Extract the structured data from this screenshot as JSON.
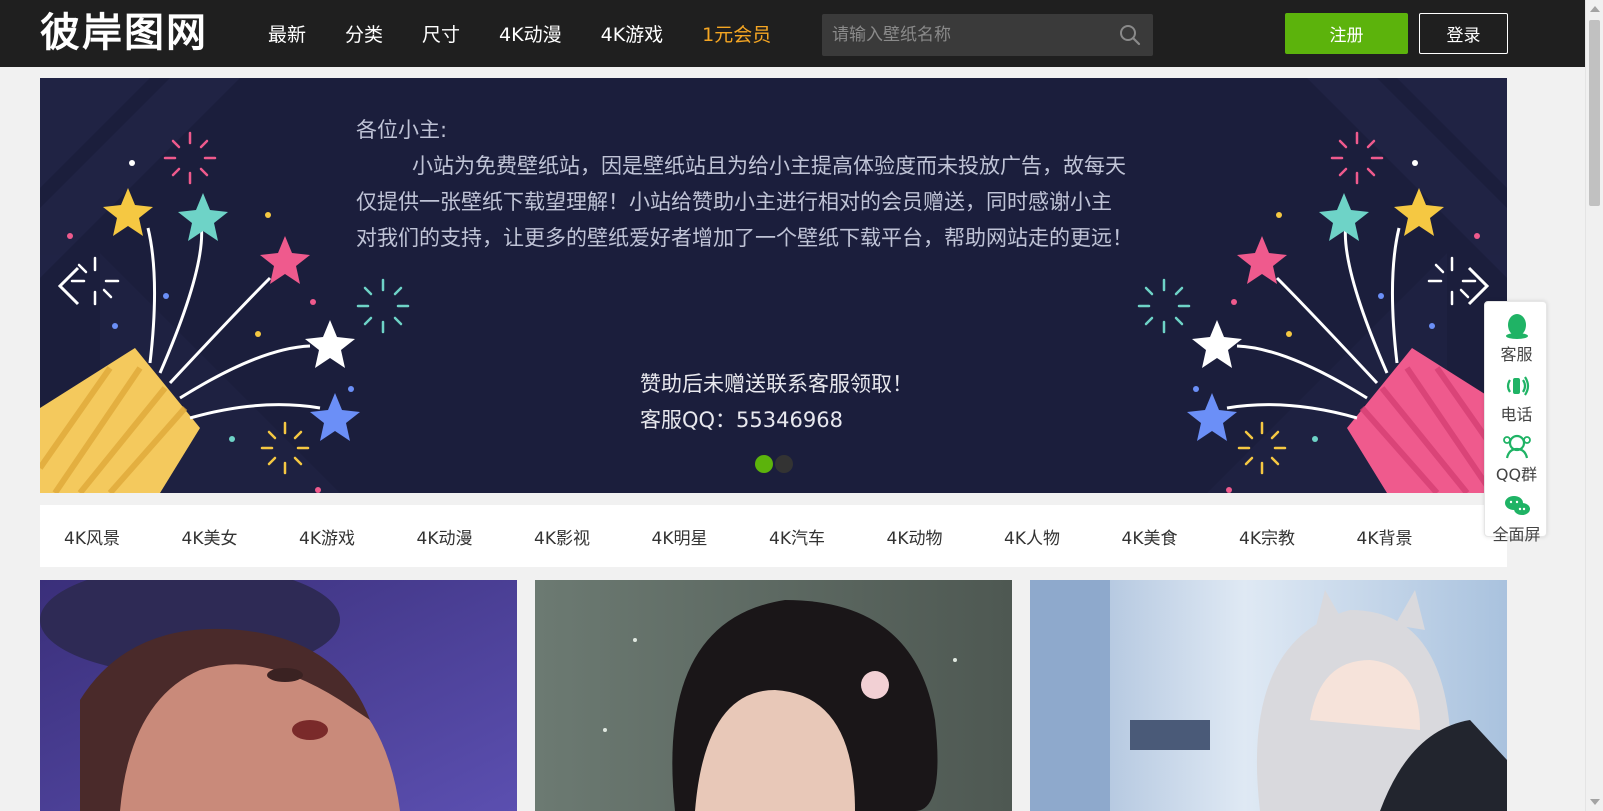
{
  "header": {
    "logo": "彼岸图网",
    "nav": [
      {
        "label": "最新"
      },
      {
        "label": "分类"
      },
      {
        "label": "尺寸"
      },
      {
        "label": "4K动漫"
      },
      {
        "label": "4K游戏"
      },
      {
        "label": "1元会员"
      }
    ],
    "search_placeholder": "请输入壁纸名称",
    "register_label": "注册",
    "login_label": "登录"
  },
  "banner": {
    "greeting": "各位小主:",
    "paragraph": [
      "小站为免费壁纸站，因是壁纸站且为给小主提高体验度而未投放广告，故每天",
      "仅提供一张壁纸下载望理解！小站给赞助小主进行相对的会员赠送，同时感谢小主",
      "对我们的支持，让更多的壁纸爱好者增加了一个壁纸下载平台，帮助网站走的更远！"
    ],
    "sponsor_note": "赞助后未赠送联系客服领取！",
    "qq_contact": "客服QQ：55346968",
    "slides_total": 2,
    "active_slide": 1
  },
  "categories": [
    "4K风景",
    "4K美女",
    "4K游戏",
    "4K动漫",
    "4K影视",
    "4K明星",
    "4K汽车",
    "4K动物",
    "4K人物",
    "4K美食",
    "4K宗教",
    "4K背景"
  ],
  "sidetool": [
    {
      "label": "客服",
      "icon": "qq-penguin-icon"
    },
    {
      "label": "电话",
      "icon": "phone-icon"
    },
    {
      "label": "QQ群",
      "icon": "qq-group-icon"
    },
    {
      "label": "全面屏",
      "icon": "wechat-icon"
    }
  ],
  "colors": {
    "header_bg": "#1f1f1f",
    "accent_green": "#5cb30c",
    "vip_orange": "#f5a623",
    "banner_bg": "#1b1e3c"
  }
}
